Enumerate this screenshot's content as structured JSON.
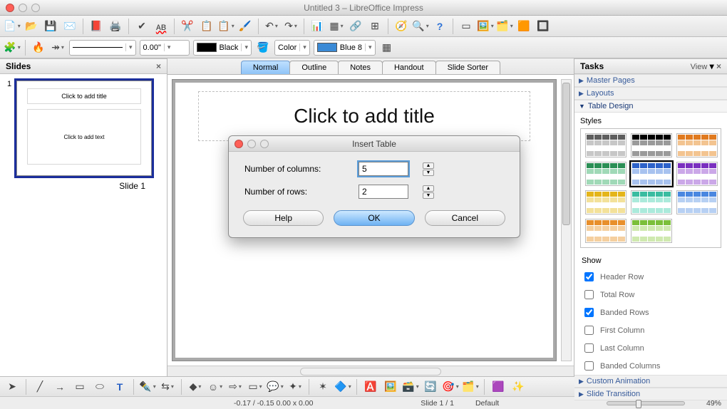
{
  "window": {
    "title": "Untitled 3 – LibreOffice Impress"
  },
  "toolbar2": {
    "measure_value": "0.00\"",
    "color1_label": "Black",
    "color_mode_label": "Color",
    "color2_label": "Blue 8"
  },
  "slides_panel": {
    "title": "Slides",
    "items": [
      {
        "num": "1",
        "title_placeholder": "Click to add title",
        "body_placeholder": "Click to add text",
        "caption": "Slide 1"
      }
    ]
  },
  "view_tabs": [
    "Normal",
    "Outline",
    "Notes",
    "Handout",
    "Slide Sorter"
  ],
  "canvas": {
    "title_placeholder": "Click to add title"
  },
  "tasks_panel": {
    "title": "Tasks",
    "view_label": "View",
    "sections": {
      "master": "Master Pages",
      "layouts": "Layouts",
      "table": "Table Design",
      "custom_anim": "Custom Animation",
      "slide_trans": "Slide Transition"
    },
    "styles_label": "Styles",
    "show_label": "Show",
    "show_options": {
      "header_row": "Header Row",
      "total_row": "Total Row",
      "banded_rows": "Banded Rows",
      "first_col": "First Column",
      "last_col": "Last Column",
      "banded_cols": "Banded Columns"
    }
  },
  "style_colors": [
    [
      "#5e5e5e",
      "#c7c7c7"
    ],
    [
      "#000000",
      "#9a9a9a"
    ],
    [
      "#e07a1f",
      "#f3c490"
    ],
    [
      "#2a8f55",
      "#a0d9b7"
    ],
    [
      "#2d62c9",
      "#a8c2ef"
    ],
    [
      "#7a2fbf",
      "#cba8e8"
    ],
    [
      "#e4b51a",
      "#f3e19a"
    ],
    [
      "#3abca0",
      "#abeadb"
    ],
    [
      "#4a87e0",
      "#b7d0f3"
    ],
    [
      "#e88f2c",
      "#f5cf9f"
    ],
    [
      "#7bbf3a",
      "#cfe9af"
    ],
    [
      "#4a87e0",
      "#b7d0f3"
    ]
  ],
  "dialog": {
    "title": "Insert Table",
    "cols_label": "Number of columns:",
    "rows_label": "Number of rows:",
    "cols_value": "5",
    "rows_value": "2",
    "help": "Help",
    "ok": "OK",
    "cancel": "Cancel"
  },
  "status": {
    "coords_sizes": "-0.17 / -0.15  0.00 x 0.00",
    "slide_index": "Slide 1 / 1",
    "template": "Default",
    "zoom": "49%"
  }
}
